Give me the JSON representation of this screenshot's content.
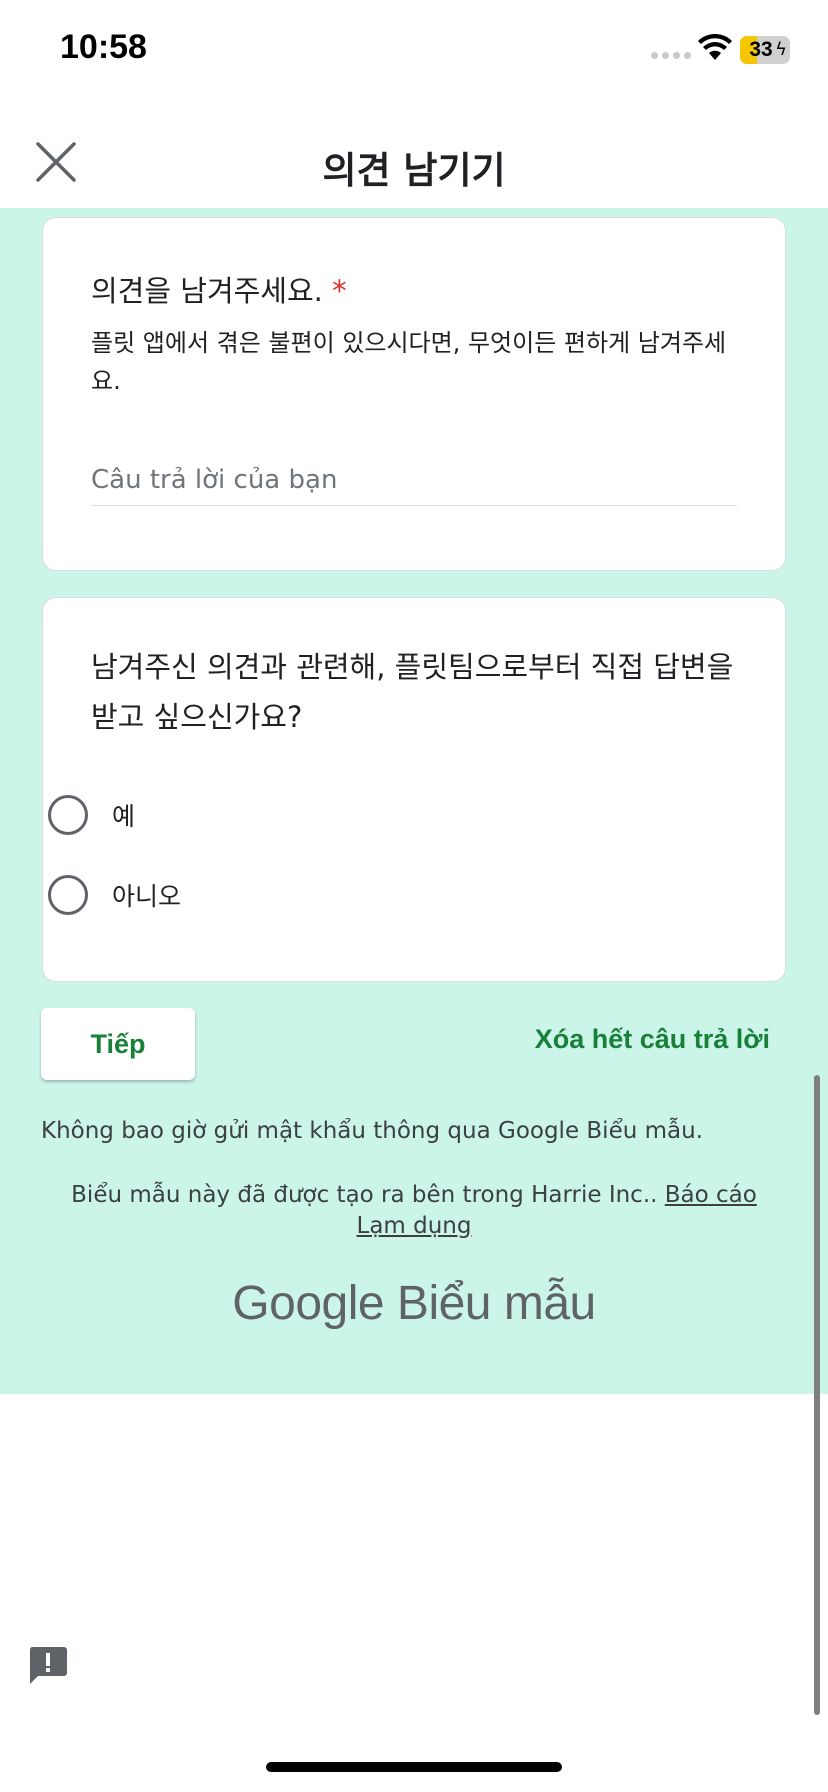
{
  "status_bar": {
    "time": "10:58",
    "battery": "33"
  },
  "header": {
    "title": "의견 남기기",
    "close_icon": "close-icon"
  },
  "form": {
    "question1": {
      "title": "의견을 남겨주세요.",
      "required_mark": "*",
      "description": "플릿 앱에서 겪은 불편이 있으시다면, 무엇이든 편하게 남겨주세요.",
      "placeholder": "Câu trả lời của bạn"
    },
    "question2": {
      "title": "남겨주신 의견과 관련해, 플릿팀으로부터 직접 답변을 받고 싶으신가요?",
      "options": [
        {
          "label": "예"
        },
        {
          "label": "아니오"
        }
      ]
    },
    "next_label": "Tiếp",
    "clear_label": "Xóa hết câu trả lời",
    "password_warning": "Không bao giờ gửi mật khẩu thông qua Google Biểu mẫu.",
    "created_text": "Biểu mẫu này đã được tạo ra bên trong Harrie Inc.. ",
    "report_link": "Báo cáo Lạm dụng",
    "logo_google": "Google",
    "logo_product": "Biểu mẫu"
  },
  "colors": {
    "background": "#ccf5ea",
    "accent": "#188038",
    "required": "#d93025"
  }
}
